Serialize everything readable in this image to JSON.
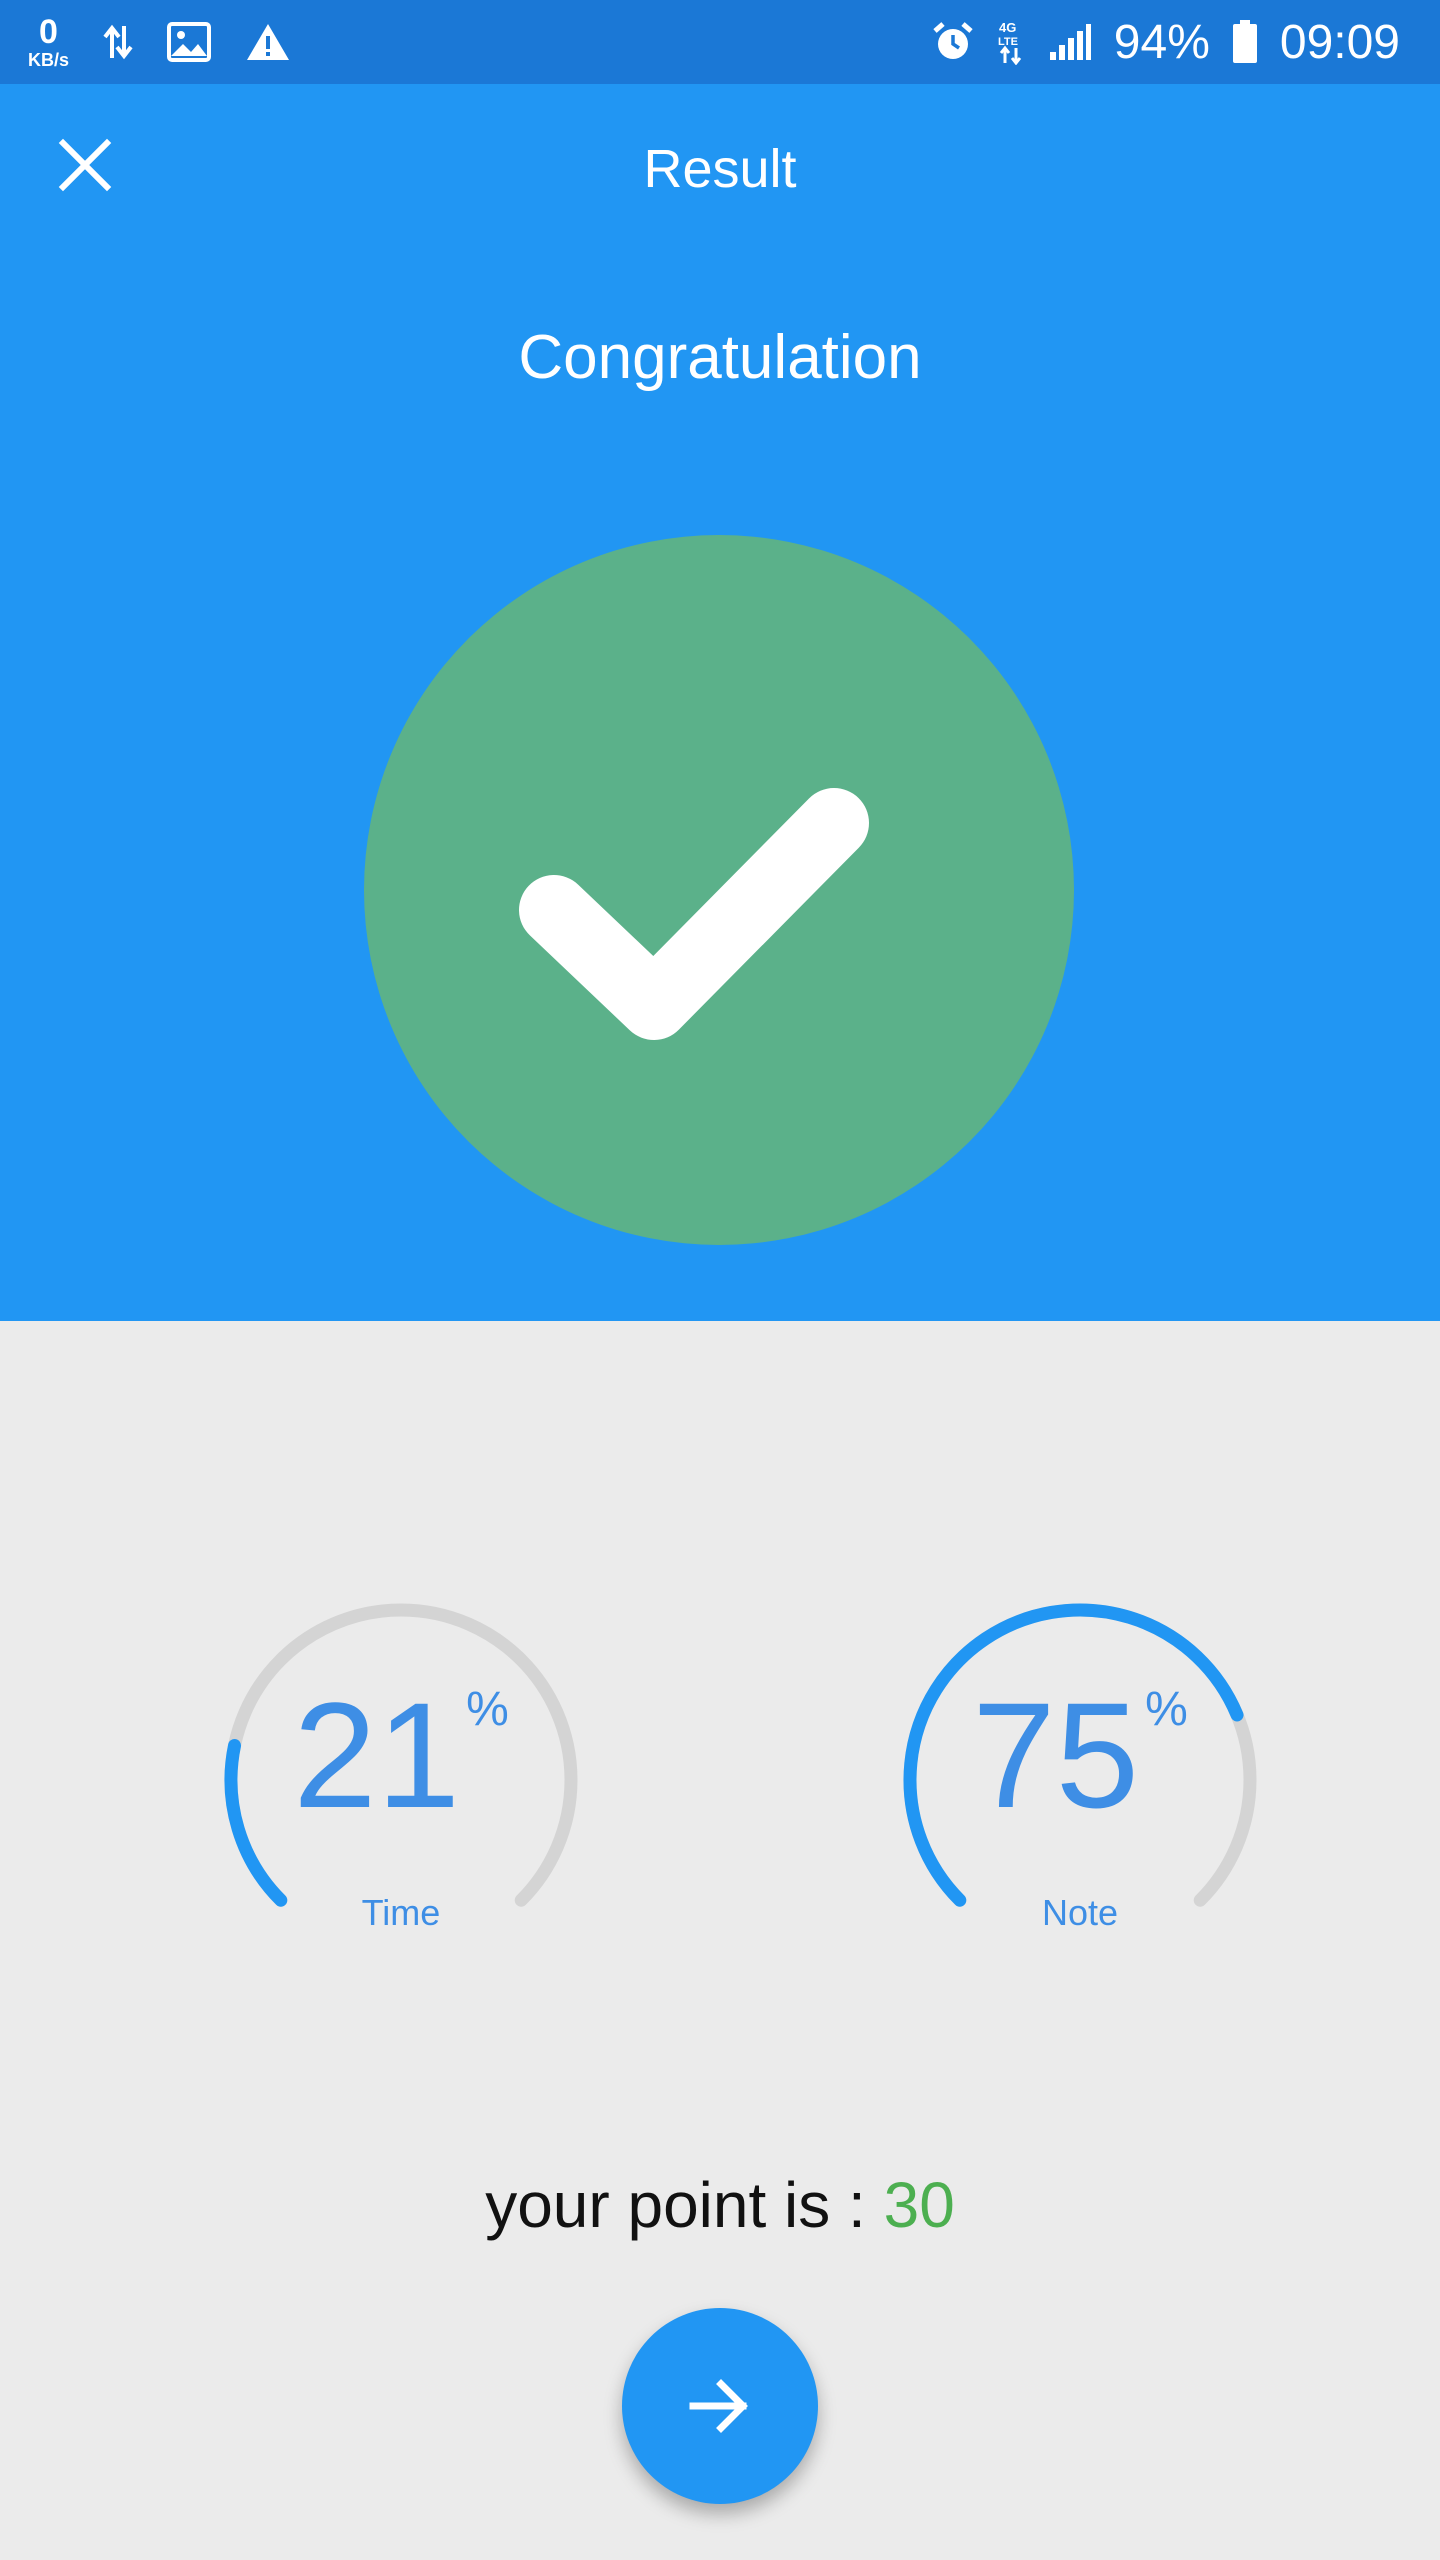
{
  "status_bar": {
    "speed_value": "0",
    "speed_unit": "KB/s",
    "battery": "94%",
    "time": "09:09",
    "icons": [
      "data-transfer-icon",
      "image-icon",
      "warning-icon",
      "alarm-icon",
      "4g-lte-icon",
      "signal-icon",
      "battery-icon"
    ]
  },
  "header": {
    "title": "Result",
    "close_icon": "close-icon"
  },
  "hero": {
    "heading": "Congratulation",
    "icon": "checkmark-icon",
    "circle_color": "#5bb18a"
  },
  "gauges": [
    {
      "value": "21",
      "unit": "%",
      "label": "Time",
      "fraction": 0.21
    },
    {
      "value": "75",
      "unit": "%",
      "label": "Note",
      "fraction": 0.75
    }
  ],
  "score": {
    "prefix": "your point is : ",
    "points": "30"
  },
  "next_button": {
    "icon": "arrow-right-icon"
  },
  "colors": {
    "primary": "#2196f3",
    "status_bar": "#1b78d6",
    "gauge_accent": "#3e8ee5",
    "gauge_track": "#d4d4d4",
    "points": "#4caf50",
    "background": "#ebebeb"
  }
}
